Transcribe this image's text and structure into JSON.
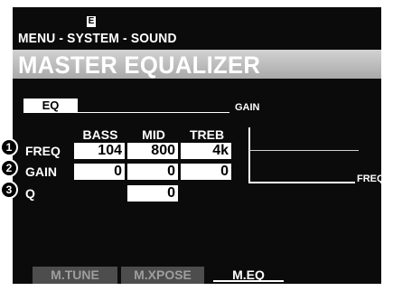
{
  "header": {
    "mode_indicator": "E",
    "breadcrumb": "MENU - SYSTEM - SOUND",
    "title": "MASTER EQUALIZER"
  },
  "eq_section": {
    "tab_label": "EQ",
    "columns": [
      "BASS",
      "MID",
      "TREB"
    ],
    "rows": [
      {
        "number": "1",
        "label": "FREQ",
        "values": [
          "104",
          "800",
          "4k"
        ]
      },
      {
        "number": "2",
        "label": "GAIN",
        "values": [
          "0",
          "0",
          "0"
        ]
      },
      {
        "number": "3",
        "label": "Q",
        "values": [
          "",
          "0",
          ""
        ]
      }
    ]
  },
  "graph": {
    "y_label": "GAIN",
    "x_label": "FREQ"
  },
  "bottom_tabs": [
    {
      "label": "M.TUNE",
      "active": false
    },
    {
      "label": "M.XPOSE",
      "active": false
    },
    {
      "label": "M.EQ",
      "active": true
    }
  ],
  "colors": {
    "screen_bg": "#0b0b0b",
    "title_bar": "#bdbdbd",
    "inactive_tab": "#4d4d4d",
    "text": "#ffffff"
  }
}
